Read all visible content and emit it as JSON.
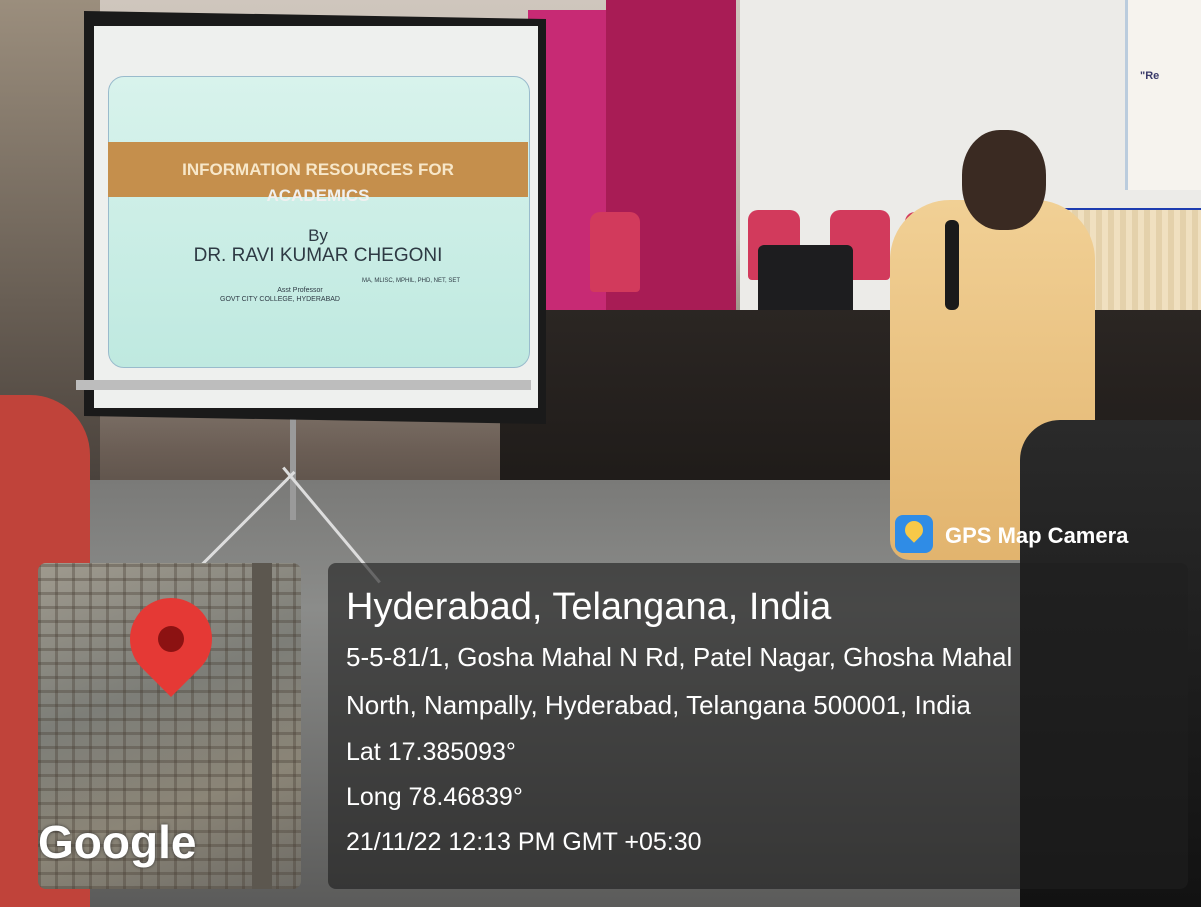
{
  "slide": {
    "title_line1": "INFORMATION RESOURCES FOR",
    "title_line2": "ACADEMICS",
    "by": "By",
    "name": "DR. RAVI KUMAR CHEGONI",
    "degrees": "MA, MLISC, MPHIL, PHD, NET, SET",
    "designation": "Asst Professor",
    "college": "GOVT CITY COLLEGE, HYDERABAD"
  },
  "banner_text": "\"Re",
  "overlay": {
    "app_name": "GPS Map Camera",
    "map_logo": "Google",
    "location_title": "Hyderabad, Telangana, India",
    "address_line1": "5-5-81/1, Gosha Mahal N Rd, Patel Nagar, Ghosha Mahal",
    "address_line2": "North, Nampally, Hyderabad, Telangana 500001, India",
    "latitude": "Lat 17.385093°",
    "longitude": "Long 78.46839°",
    "datetime": "21/11/22 12:13 PM GMT +05:30"
  },
  "icons": {
    "app_icon": "gps-map-camera-icon",
    "pin_icon": "map-pin-icon"
  },
  "colors": {
    "pin": "#e53935",
    "slide_band": "#c58f4c",
    "stage_panel": "#c72a74"
  }
}
